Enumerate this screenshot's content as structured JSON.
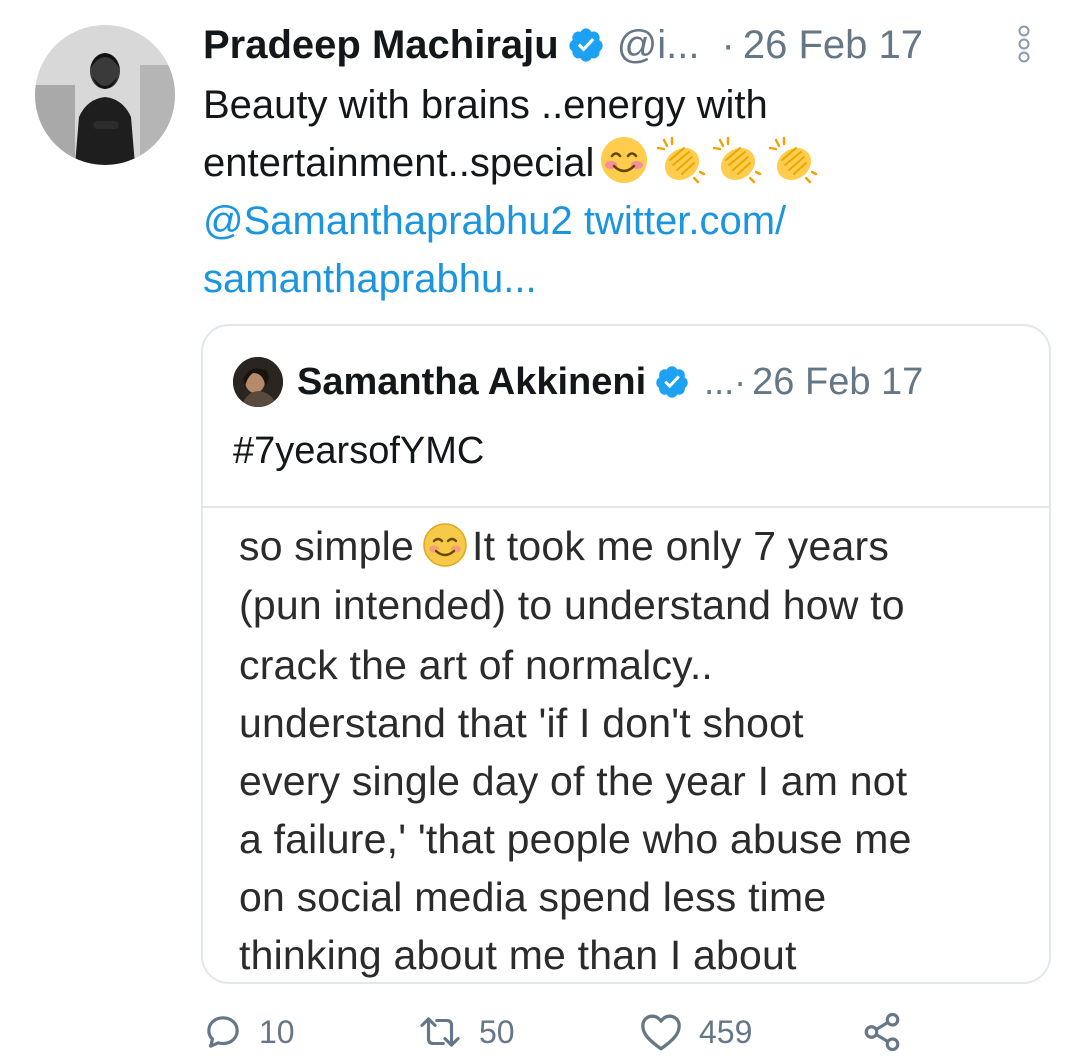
{
  "tweet": {
    "author_name": "Pradeep Machiraju",
    "handle": "@i...",
    "separator": "·",
    "date": "26 Feb 17",
    "text_line1": "Beauty with brains ..energy with",
    "text_line2": "entertainment..special",
    "mention": "@Samanthaprabhu2",
    "link_part1": "twitter.com/",
    "link_part2": "samanthaprabhu..."
  },
  "quoted_tweet": {
    "author_name": "Samantha Akkineni",
    "ellipsis": "...·",
    "date": "26 Feb 17",
    "text": "#7yearsofYMC",
    "image_lines": [
      "It took me only 7 years",
      "(pun intended) to understand how to",
      "crack the art of normalcy..",
      "understand that 'if I don't shoot",
      "every single day of the year I am not",
      "a failure,' 'that people who abuse me",
      "on social media spend less time",
      "thinking about me than I about"
    ],
    "image_first_prefix": "so simple"
  },
  "actions": {
    "reply_count": "10",
    "retweet_count": "50",
    "like_count": "459"
  },
  "colors": {
    "link": "#1b95e0",
    "secondary_text": "#657786",
    "verified": "#1da1f2",
    "border": "#e1e8ed"
  },
  "icons": {
    "verified": "verified-badge-icon",
    "more": "more-vertical-icon",
    "reply": "reply-icon",
    "retweet": "retweet-icon",
    "like": "heart-icon",
    "share": "share-icon"
  }
}
